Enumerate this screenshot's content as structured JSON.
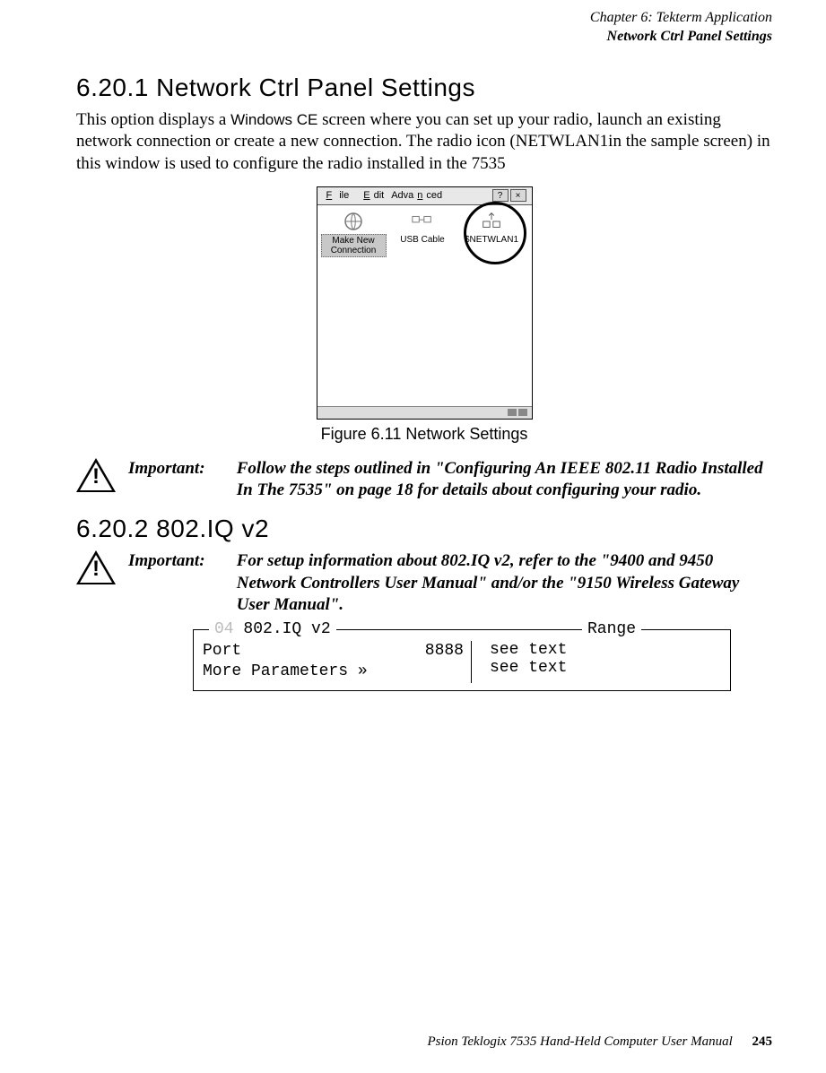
{
  "header": {
    "chapter_line": "Chapter  6:  Tekterm Application",
    "section_line": "Network Ctrl Panel Settings"
  },
  "section1": {
    "heading": "6.20.1   Network  Ctrl  Panel  Settings",
    "body_pre": "This option displays a ",
    "body_ce": "Windows CE",
    "body_post": " screen where you can set up your radio, launch an existing network connection or create a new connection. The radio icon (NETWLAN1in the sample screen) in this window is used to configure the radio installed in the 7535"
  },
  "screenshot": {
    "menu": {
      "file": "File",
      "edit": "Edit",
      "advanced": "Advanced",
      "help": "?",
      "close": "×"
    },
    "icons": {
      "makenew": {
        "label": "Make New Connection"
      },
      "usb": {
        "label": "USB Cable"
      },
      "netwlan": {
        "label": "$NETWLAN1"
      }
    }
  },
  "figure_caption": "Figure  6.11  Network  Settings",
  "important1": {
    "label": "Important:",
    "text": "Follow the steps outlined in \"Configuring An IEEE 802.11 Radio Installed In The 7535\" on page 18 for details about configuring your radio."
  },
  "section2": {
    "heading": "6.20.2   802.IQ  v2"
  },
  "important2": {
    "label": "Important:",
    "text": "For setup information about 802.IQ v2, refer to the \"9400 and 9450 Network Controllers User Manual\" and/or the \"9150 Wireless Gateway User Manual\"."
  },
  "params": {
    "legend_num": "04",
    "legend_title": "802.IQ v2",
    "legend_range": "Range",
    "rows": [
      {
        "label": "Port",
        "value": "8888",
        "range": "see text"
      },
      {
        "label": "More Parameters »",
        "value": "",
        "range": "see text"
      }
    ]
  },
  "footer": {
    "text": "Psion Teklogix 7535 Hand-Held Computer User Manual",
    "page": "245"
  }
}
